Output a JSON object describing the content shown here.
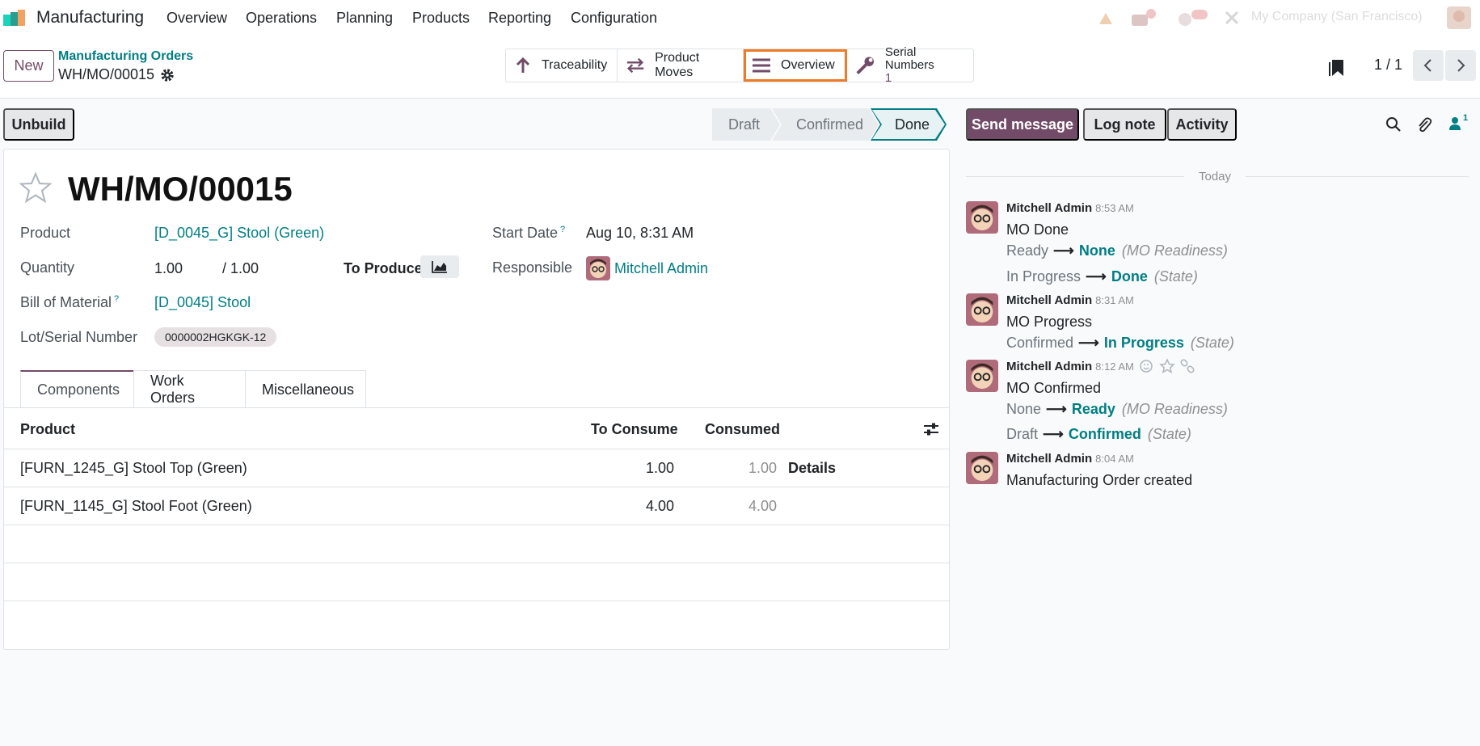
{
  "navbar": {
    "app_name": "Manufacturing",
    "menus": [
      "Overview",
      "Operations",
      "Planning",
      "Products",
      "Reporting",
      "Configuration"
    ],
    "company": "My Company (San Francisco)"
  },
  "control_panel": {
    "new_label": "New",
    "breadcrumb_parent": "Manufacturing Orders",
    "breadcrumb_current": "WH/MO/00015",
    "smart_buttons": {
      "traceability": "Traceability",
      "product_moves": "Product Moves",
      "overview": "Overview",
      "serial_numbers": "Serial Numbers",
      "serial_numbers_count": "1"
    },
    "pager": "1 / 1"
  },
  "status": {
    "unbuild_label": "Unbuild",
    "stages": [
      "Draft",
      "Confirmed",
      "Done"
    ],
    "active_stage": "Done"
  },
  "form": {
    "title": "WH/MO/00015",
    "product_label": "Product",
    "product_value": "[D_0045_G] Stool (Green)",
    "quantity_label": "Quantity",
    "quantity_value": "1.00",
    "quantity_total": "/ 1.00",
    "to_produce_label": "To Produce",
    "bom_label": "Bill of Material",
    "bom_help": "?",
    "bom_value": "[D_0045] Stool",
    "lot_label": "Lot/Serial Number",
    "lot_value": "0000002HGKGK-12",
    "start_date_label": "Start Date",
    "start_date_help": "?",
    "start_date_value": "Aug 10, 8:31 AM",
    "responsible_label": "Responsible",
    "responsible_value": "Mitchell Admin"
  },
  "tabs": [
    "Components",
    "Work Orders",
    "Miscellaneous"
  ],
  "table": {
    "headers": {
      "product": "Product",
      "to_consume": "To Consume",
      "consumed": "Consumed"
    },
    "rows": [
      {
        "product": "[FURN_1245_G] Stool Top (Green)",
        "to_consume": "1.00",
        "consumed": "1.00",
        "action": "Details"
      },
      {
        "product": "[FURN_1145_G] Stool Foot (Green)",
        "to_consume": "4.00",
        "consumed": "4.00",
        "action": ""
      }
    ]
  },
  "chatter": {
    "send_message": "Send message",
    "log_note": "Log note",
    "activity": "Activity",
    "followers_count": "1",
    "date_separator": "Today",
    "messages": [
      {
        "author": "Mitchell Admin",
        "time": "8:53 AM",
        "body": "MO Done",
        "tracking": [
          {
            "old": "Ready",
            "new": "None",
            "field": "(MO Readiness)"
          },
          {
            "old": "In Progress",
            "new": "Done",
            "field": "(State)"
          }
        ]
      },
      {
        "author": "Mitchell Admin",
        "time": "8:31 AM",
        "body": "MO Progress",
        "tracking": [
          {
            "old": "Confirmed",
            "new": "In Progress",
            "field": "(State)"
          }
        ]
      },
      {
        "author": "Mitchell Admin",
        "time": "8:12 AM",
        "body": "MO Confirmed",
        "tracking": [
          {
            "old": "None",
            "new": "Ready",
            "field": "(MO Readiness)"
          },
          {
            "old": "Draft",
            "new": "Confirmed",
            "field": "(State)"
          }
        ]
      },
      {
        "author": "Mitchell Admin",
        "time": "8:04 AM",
        "body": "Manufacturing Order created",
        "tracking": []
      }
    ]
  },
  "colors": {
    "brand": "#714b67",
    "link": "#017e84",
    "highlight": "#f07b25"
  }
}
